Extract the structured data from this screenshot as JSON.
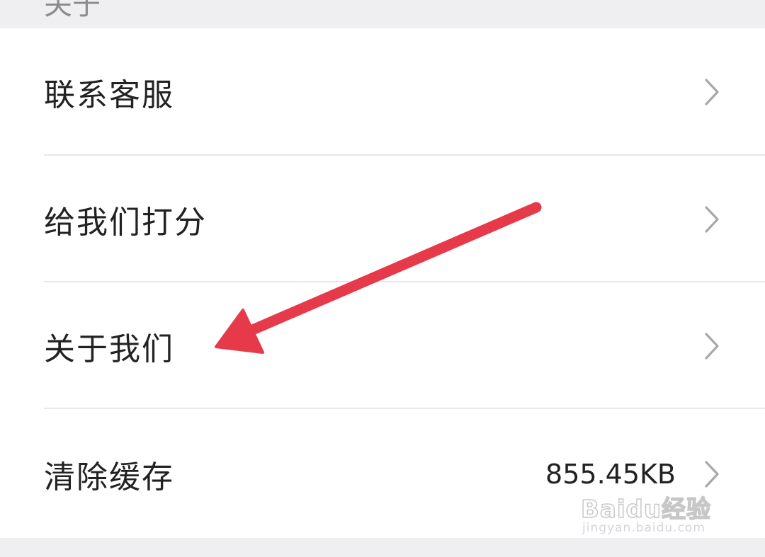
{
  "header": {
    "section_label": "关于"
  },
  "menu": {
    "items": [
      {
        "label": "联系客服",
        "value": ""
      },
      {
        "label": "给我们打分",
        "value": ""
      },
      {
        "label": "关于我们",
        "value": ""
      },
      {
        "label": "清除缓存",
        "value": "855.45KB"
      }
    ]
  },
  "annotation": {
    "arrow_color": "#e63a4b",
    "points_to": "关于我们"
  },
  "watermark": {
    "logo_text": "Baidu经验",
    "url": "jingyan.baidu.com"
  },
  "icons": {
    "row_chevron": "chevron-right-icon"
  }
}
